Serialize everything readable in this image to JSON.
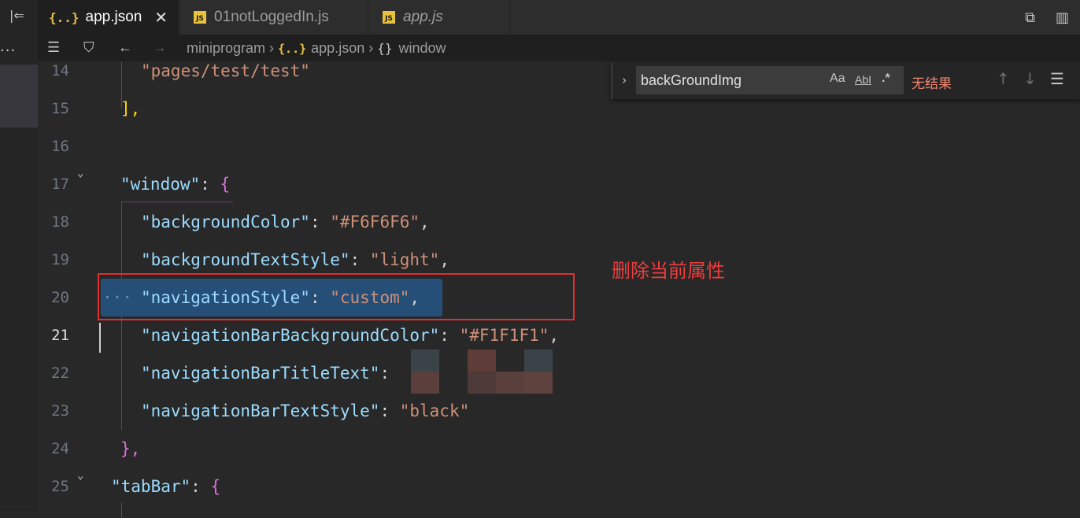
{
  "tabs": [
    {
      "icon": "{..}",
      "label": "app.json",
      "active": true,
      "close": "✕"
    },
    {
      "icon": "JS",
      "label": "01notLoggedIn.js",
      "active": false
    },
    {
      "icon": "JS",
      "label": "app.js",
      "active": false
    }
  ],
  "breadcrumb": {
    "items": [
      "miniprogram",
      "app.json",
      "window"
    ],
    "json_icon": "{..}",
    "object_icon": "{}"
  },
  "find": {
    "query": "backGroundImg",
    "match_case": "Aa",
    "whole_word": "AbI",
    "regex": ".*",
    "result": "无结果"
  },
  "editor": {
    "current_line": 21,
    "lines": [
      {
        "n": "14",
        "text": "\"pages/test/test\""
      },
      {
        "n": "15",
        "text": "],"
      },
      {
        "n": "16",
        "text": ""
      },
      {
        "n": "17",
        "key": "\"window\"",
        "text": "{"
      },
      {
        "n": "18",
        "key": "\"backgroundColor\"",
        "value": "\"#F6F6F6\""
      },
      {
        "n": "19",
        "key": "\"backgroundTextStyle\"",
        "value": "\"light\""
      },
      {
        "n": "20",
        "key": "\"navigationStyle\"",
        "value": "\"custom\""
      },
      {
        "n": "21",
        "key": "\"navigationBarBackgroundColor\"",
        "value": "\"#F1F1F1\""
      },
      {
        "n": "22",
        "key": "\"navigationBarTitleText\"",
        "value": ""
      },
      {
        "n": "23",
        "key": "\"navigationBarTextStyle\"",
        "value": "\"black\""
      },
      {
        "n": "24",
        "text": "},"
      },
      {
        "n": "25",
        "key": "\"tabBar\"",
        "text": "{"
      }
    ]
  },
  "annotation": "删除当前属性",
  "colors": {
    "key": "#9cdcfe",
    "string": "#ce9178",
    "annotation": "#f03c3c",
    "selection": "#264f78"
  }
}
